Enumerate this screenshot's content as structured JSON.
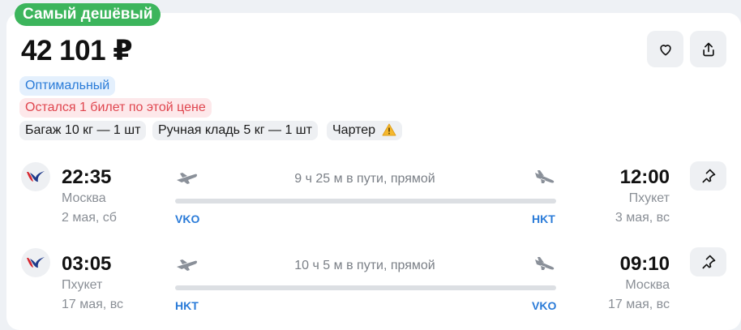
{
  "badge": "Самый дешёвый",
  "price": "42 101 ₽",
  "tags": {
    "class": "Оптимальный",
    "tickets_left": "Остался 1 билет по этой цене",
    "baggage": "Багаж 10 кг — 1 шт",
    "hand_luggage": "Ручная кладь 5 кг — 1 шт",
    "charter": "Чартер"
  },
  "icons": {
    "favorite": "heart-icon",
    "share": "share-icon",
    "pin": "pin-icon",
    "warning": "warning-icon",
    "takeoff": "takeoff-icon",
    "landing": "landing-icon"
  },
  "colors": {
    "badge": "#3cb55c",
    "accent_blue": "#2a7bd8",
    "alert_red": "#e0464f",
    "airline_blue": "#1f3a8a",
    "airline_red": "#d7262e"
  },
  "segments": [
    {
      "dep_time": "22:35",
      "dep_city": "Москва",
      "dep_date": "2 мая, сб",
      "dep_code": "VKO",
      "duration": "9 ч 25 м в пути, прямой",
      "arr_time": "12:00",
      "arr_city": "Пхукет",
      "arr_date": "3 мая, вс",
      "arr_code": "HKT"
    },
    {
      "dep_time": "03:05",
      "dep_city": "Пхукет",
      "dep_date": "17 мая, вс",
      "dep_code": "HKT",
      "duration": "10 ч 5 м в пути, прямой",
      "arr_time": "09:10",
      "arr_city": "Москва",
      "arr_date": "17 мая, вс",
      "arr_code": "VKO"
    }
  ]
}
